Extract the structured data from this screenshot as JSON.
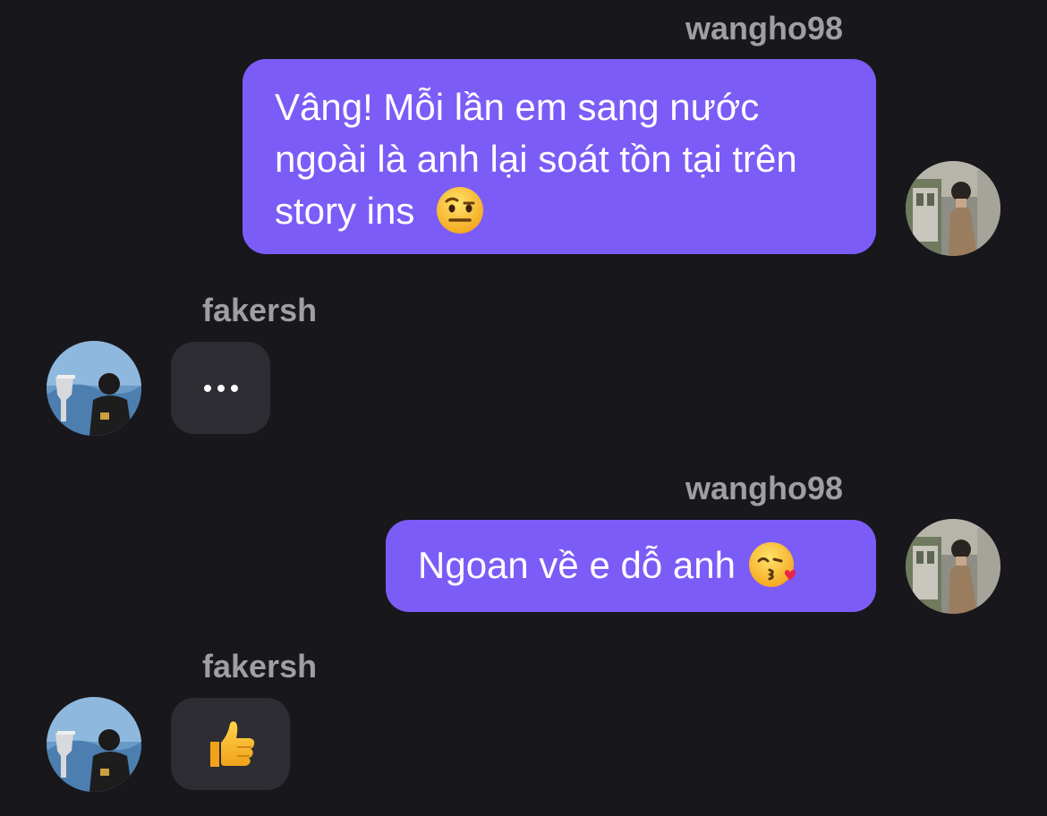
{
  "messages": [
    {
      "sender": "wangho98",
      "direction": "out",
      "text": "Vâng! Mỗi lần em sang nước ngoài là anh lại soát tồn tại trên story ins",
      "emoji": "face-with-raised-eyebrow"
    },
    {
      "sender": "fakersh",
      "direction": "in",
      "text": "...",
      "emoji": ""
    },
    {
      "sender": "wangho98",
      "direction": "out",
      "text": "Ngoan về e dỗ anh",
      "emoji": "face-blowing-kiss"
    },
    {
      "sender": "fakersh",
      "direction": "in",
      "text": "",
      "emoji": "thumbs-up"
    }
  ],
  "colors": {
    "background": "#18171c",
    "outgoing_bubble": "#7c5cf7",
    "incoming_bubble": "#2e2d33",
    "username": "#9e9ea4",
    "text": "#ffffff"
  }
}
